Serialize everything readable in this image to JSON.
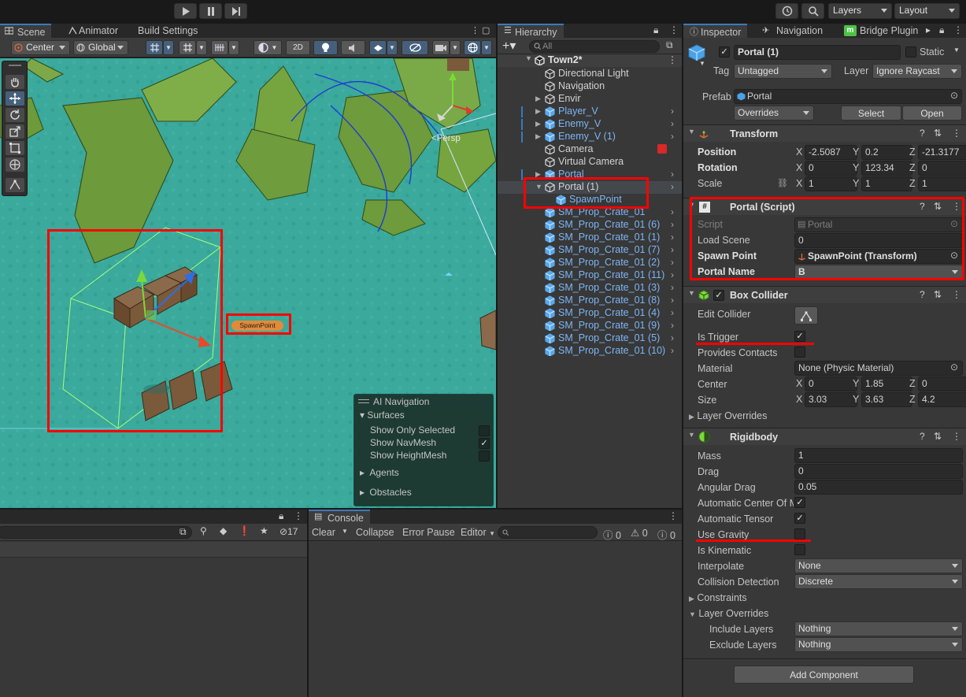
{
  "toolbar": {
    "layers_label": "Layers",
    "layout_label": "Layout"
  },
  "scene": {
    "tabs": [
      "Scene",
      "Animator",
      "Build Settings"
    ],
    "pivot_label": "Center",
    "space_label": "Global",
    "mode_2d": "2D",
    "persp_label": "<Persp",
    "spawn_label": "SpawnPoint",
    "ai_nav": {
      "title": "AI Navigation",
      "surfaces": "Surfaces",
      "show_only_selected": "Show Only Selected",
      "show_navmesh": "Show NavMesh",
      "show_heightmesh": "Show HeightMesh",
      "agents": "Agents",
      "obstacles": "Obstacles"
    }
  },
  "hierarchy": {
    "tab": "Hierarchy",
    "search_placeholder": "All",
    "scene_name": "Town2*",
    "items": [
      {
        "name": "Directional Light",
        "color": "#d2d2d2"
      },
      {
        "name": "Navigation",
        "color": "#d2d2d2"
      },
      {
        "name": "Envir",
        "color": "#d2d2d2"
      },
      {
        "name": "Player_V",
        "color": "#7cb5f5"
      },
      {
        "name": "Enemy_V",
        "color": "#7cb5f5"
      },
      {
        "name": "Enemy_V (1)",
        "color": "#7cb5f5"
      },
      {
        "name": "Camera",
        "color": "#d2d2d2"
      },
      {
        "name": "Virtual Camera",
        "color": "#d2d2d2"
      },
      {
        "name": "Portal",
        "color": "#7cb5f5"
      },
      {
        "name": "Portal (1)",
        "color": "#d2d2d2"
      },
      {
        "name": "SpawnPoint",
        "color": "#7cb5f5"
      },
      {
        "name": "SM_Prop_Crate_01",
        "color": "#7cb5f5"
      },
      {
        "name": "SM_Prop_Crate_01 (6)",
        "color": "#7cb5f5"
      },
      {
        "name": "SM_Prop_Crate_01 (1)",
        "color": "#7cb5f5"
      },
      {
        "name": "SM_Prop_Crate_01 (7)",
        "color": "#7cb5f5"
      },
      {
        "name": "SM_Prop_Crate_01 (2)",
        "color": "#7cb5f5"
      },
      {
        "name": "SM_Prop_Crate_01 (11)",
        "color": "#7cb5f5"
      },
      {
        "name": "SM_Prop_Crate_01 (3)",
        "color": "#7cb5f5"
      },
      {
        "name": "SM_Prop_Crate_01 (8)",
        "color": "#7cb5f5"
      },
      {
        "name": "SM_Prop_Crate_01 (4)",
        "color": "#7cb5f5"
      },
      {
        "name": "SM_Prop_Crate_01 (9)",
        "color": "#7cb5f5"
      },
      {
        "name": "SM_Prop_Crate_01 (5)",
        "color": "#7cb5f5"
      },
      {
        "name": "SM_Prop_Crate_01 (10)",
        "color": "#7cb5f5"
      }
    ]
  },
  "project": {
    "hidden_count": "17"
  },
  "console": {
    "tab": "Console",
    "clear": "Clear",
    "collapse": "Collapse",
    "error_pause": "Error Pause",
    "editor": "Editor",
    "log_count": "0",
    "warn_count": "0",
    "error_count": "0"
  },
  "inspector": {
    "tabs": [
      "Inspector",
      "Navigation",
      "Bridge Plugin"
    ],
    "object_name": "Portal (1)",
    "static_label": "Static",
    "tag_label": "Tag",
    "tag_value": "Untagged",
    "layer_label": "Layer",
    "layer_value": "Ignore Raycast",
    "prefab_label": "Prefab",
    "prefab_value": "Portal",
    "overrides": "Overrides",
    "select": "Select",
    "open": "Open",
    "transform": {
      "title": "Transform",
      "position_label": "Position",
      "rotation_label": "Rotation",
      "scale_label": "Scale",
      "position": [
        "-2.5087",
        "0.2",
        "-21.3177"
      ],
      "rotation": [
        "0",
        "123.34",
        "0"
      ],
      "scale": [
        "1",
        "1",
        "1"
      ]
    },
    "portal_script": {
      "title": "Portal (Script)",
      "script_label": "Script",
      "script_value": "Portal",
      "load_scene_label": "Load Scene",
      "load_scene_value": "0",
      "spawn_point_label": "Spawn Point",
      "spawn_point_value": "SpawnPoint (Transform)",
      "portal_name_label": "Portal Name",
      "portal_name_value": "B"
    },
    "box_collider": {
      "title": "Box Collider",
      "edit_collider": "Edit Collider",
      "is_trigger": "Is Trigger",
      "provides_contacts": "Provides Contacts",
      "material_label": "Material",
      "material_value": "None (Physic Material)",
      "center_label": "Center",
      "size_label": "Size",
      "center": [
        "0",
        "1.85",
        "0"
      ],
      "size": [
        "3.03",
        "3.63",
        "4.2"
      ],
      "layer_overrides": "Layer Overrides"
    },
    "rigidbody": {
      "title": "Rigidbody",
      "mass_label": "Mass",
      "mass": "1",
      "drag_label": "Drag",
      "drag": "0",
      "angular_drag_label": "Angular Drag",
      "angular_drag": "0.05",
      "auto_com": "Automatic Center Of M",
      "auto_tensor": "Automatic Tensor",
      "use_gravity": "Use Gravity",
      "is_kinematic": "Is Kinematic",
      "interpolate_label": "Interpolate",
      "interpolate": "None",
      "collision_label": "Collision Detection",
      "collision": "Discrete",
      "constraints": "Constraints",
      "layer_overrides": "Layer Overrides",
      "include_label": "Include Layers",
      "include": "Nothing",
      "exclude_label": "Exclude Layers",
      "exclude": "Nothing"
    },
    "add_component": "Add Component"
  }
}
